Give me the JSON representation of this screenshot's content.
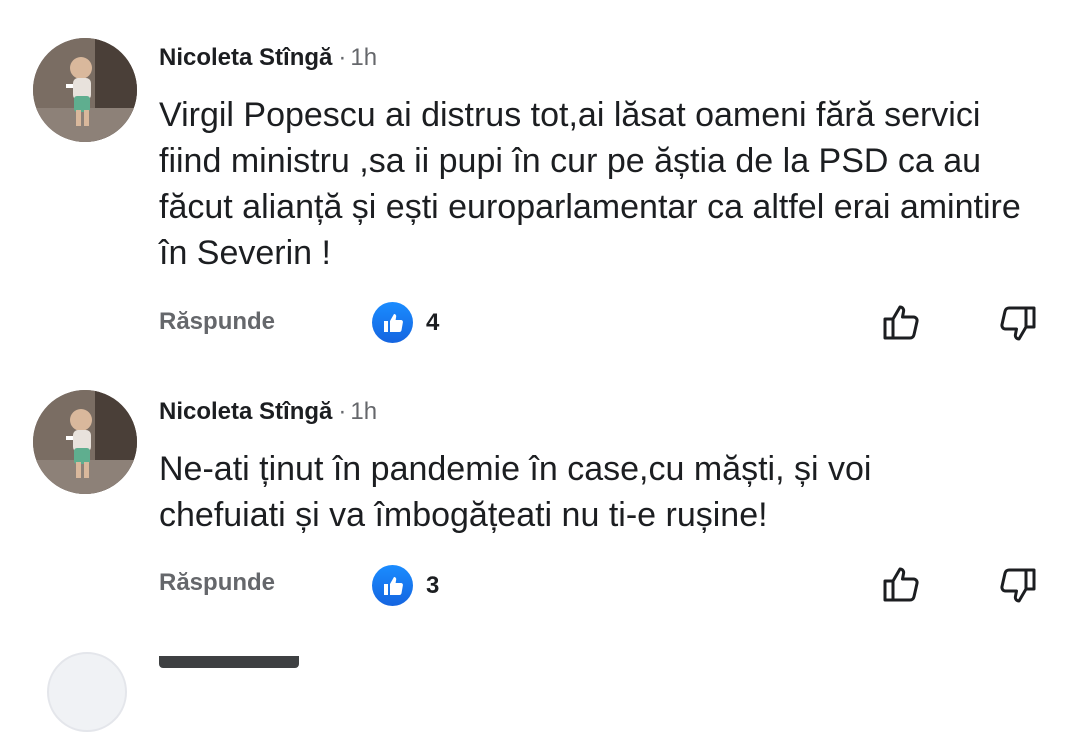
{
  "comments": [
    {
      "author": "Nicoleta Stîngă",
      "separator": "·",
      "time": "1h",
      "text": "Virgil Popescu ai distrus tot,ai lăsat oameni fără servici fiind ministru ,sa ii pupi în cur pe ăștia de la PSD ca au făcut alianță și ești europarlamentar ca altfel erai amintire în Severin !",
      "reply_label": "Răspunde",
      "like_count": "4"
    },
    {
      "author": "Nicoleta Stîngă",
      "separator": "·",
      "time": "1h",
      "text": "Ne-ati ținut în pandemie în case,cu măști, și voi chefuiati și va îmbogățeati nu ti-e rușine!",
      "reply_label": "Răspunde",
      "like_count": "3"
    }
  ],
  "icons": {
    "like_badge": "thumbs-up-icon",
    "upvote": "thumbs-up-outline-icon",
    "downvote": "thumbs-down-outline-icon"
  },
  "colors": {
    "like_blue": "#1877f2",
    "secondary_text": "#65676b"
  }
}
